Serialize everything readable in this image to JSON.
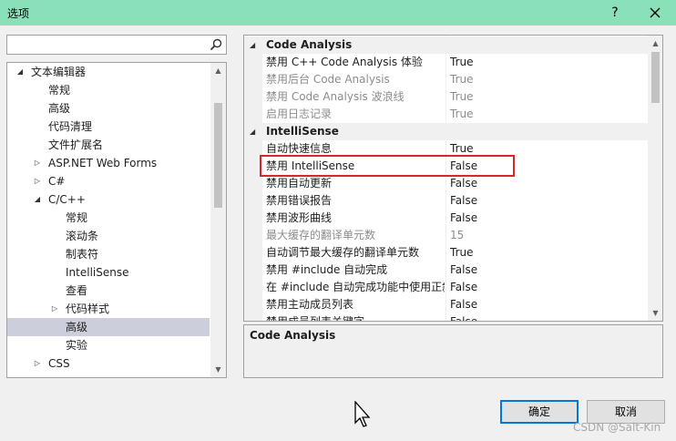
{
  "window": {
    "title": "选项",
    "help": "?",
    "close": "✕"
  },
  "search": {
    "placeholder": "",
    "value": ""
  },
  "tree": {
    "items": [
      {
        "label": "文本编辑器",
        "expander": "expanded"
      },
      {
        "label": "常规"
      },
      {
        "label": "高级"
      },
      {
        "label": "代码清理"
      },
      {
        "label": "文件扩展名"
      },
      {
        "label": "ASP.NET Web Forms",
        "expander": "collapsed"
      },
      {
        "label": "C#",
        "expander": "collapsed"
      },
      {
        "label": "C/C++",
        "expander": "expanded"
      },
      {
        "label": "常规"
      },
      {
        "label": "滚动条"
      },
      {
        "label": "制表符"
      },
      {
        "label": "IntelliSense"
      },
      {
        "label": "查看"
      },
      {
        "label": "代码样式",
        "expander": "collapsed"
      },
      {
        "label": "高级",
        "selected": true
      },
      {
        "label": "实验"
      },
      {
        "label": "CSS",
        "expander": "collapsed"
      }
    ]
  },
  "properties": {
    "categories": [
      {
        "name": "Code Analysis",
        "rows": [
          {
            "name": "禁用 C++ Code Analysis 体验",
            "value": "True"
          },
          {
            "name": "禁用后台 Code Analysis",
            "value": "True",
            "disabled": true
          },
          {
            "name": "禁用 Code Analysis 波浪线",
            "value": "True",
            "disabled": true
          },
          {
            "name": "启用日志记录",
            "value": "True",
            "disabled": true
          }
        ]
      },
      {
        "name": "IntelliSense",
        "rows": [
          {
            "name": "自动快速信息",
            "value": "True"
          },
          {
            "name": "禁用 IntelliSense",
            "value": "False",
            "highlighted": true
          },
          {
            "name": "禁用自动更新",
            "value": "False"
          },
          {
            "name": "禁用错误报告",
            "value": "False"
          },
          {
            "name": "禁用波形曲线",
            "value": "False"
          },
          {
            "name": "最大缓存的翻译单元数",
            "value": "15",
            "disabled": true
          },
          {
            "name": "自动调节最大缓存的翻译单元数",
            "value": "True"
          },
          {
            "name": "禁用 #include 自动完成",
            "value": "False"
          },
          {
            "name": "在 #include 自动完成功能中使用正斜杠",
            "value": "False"
          },
          {
            "name": "禁用主动成员列表",
            "value": "False"
          },
          {
            "name": "禁用成员列表关键字",
            "value": "False"
          }
        ]
      }
    ]
  },
  "description": {
    "title": "Code Analysis"
  },
  "buttons": {
    "ok": "确定",
    "cancel": "取消"
  },
  "watermark": "CSDN @Salt-Kin",
  "colors": {
    "titlebar": "#89e0b9",
    "selection": "#cccedb",
    "highlight_border": "#d6262e",
    "primary_border": "#0078d7"
  }
}
